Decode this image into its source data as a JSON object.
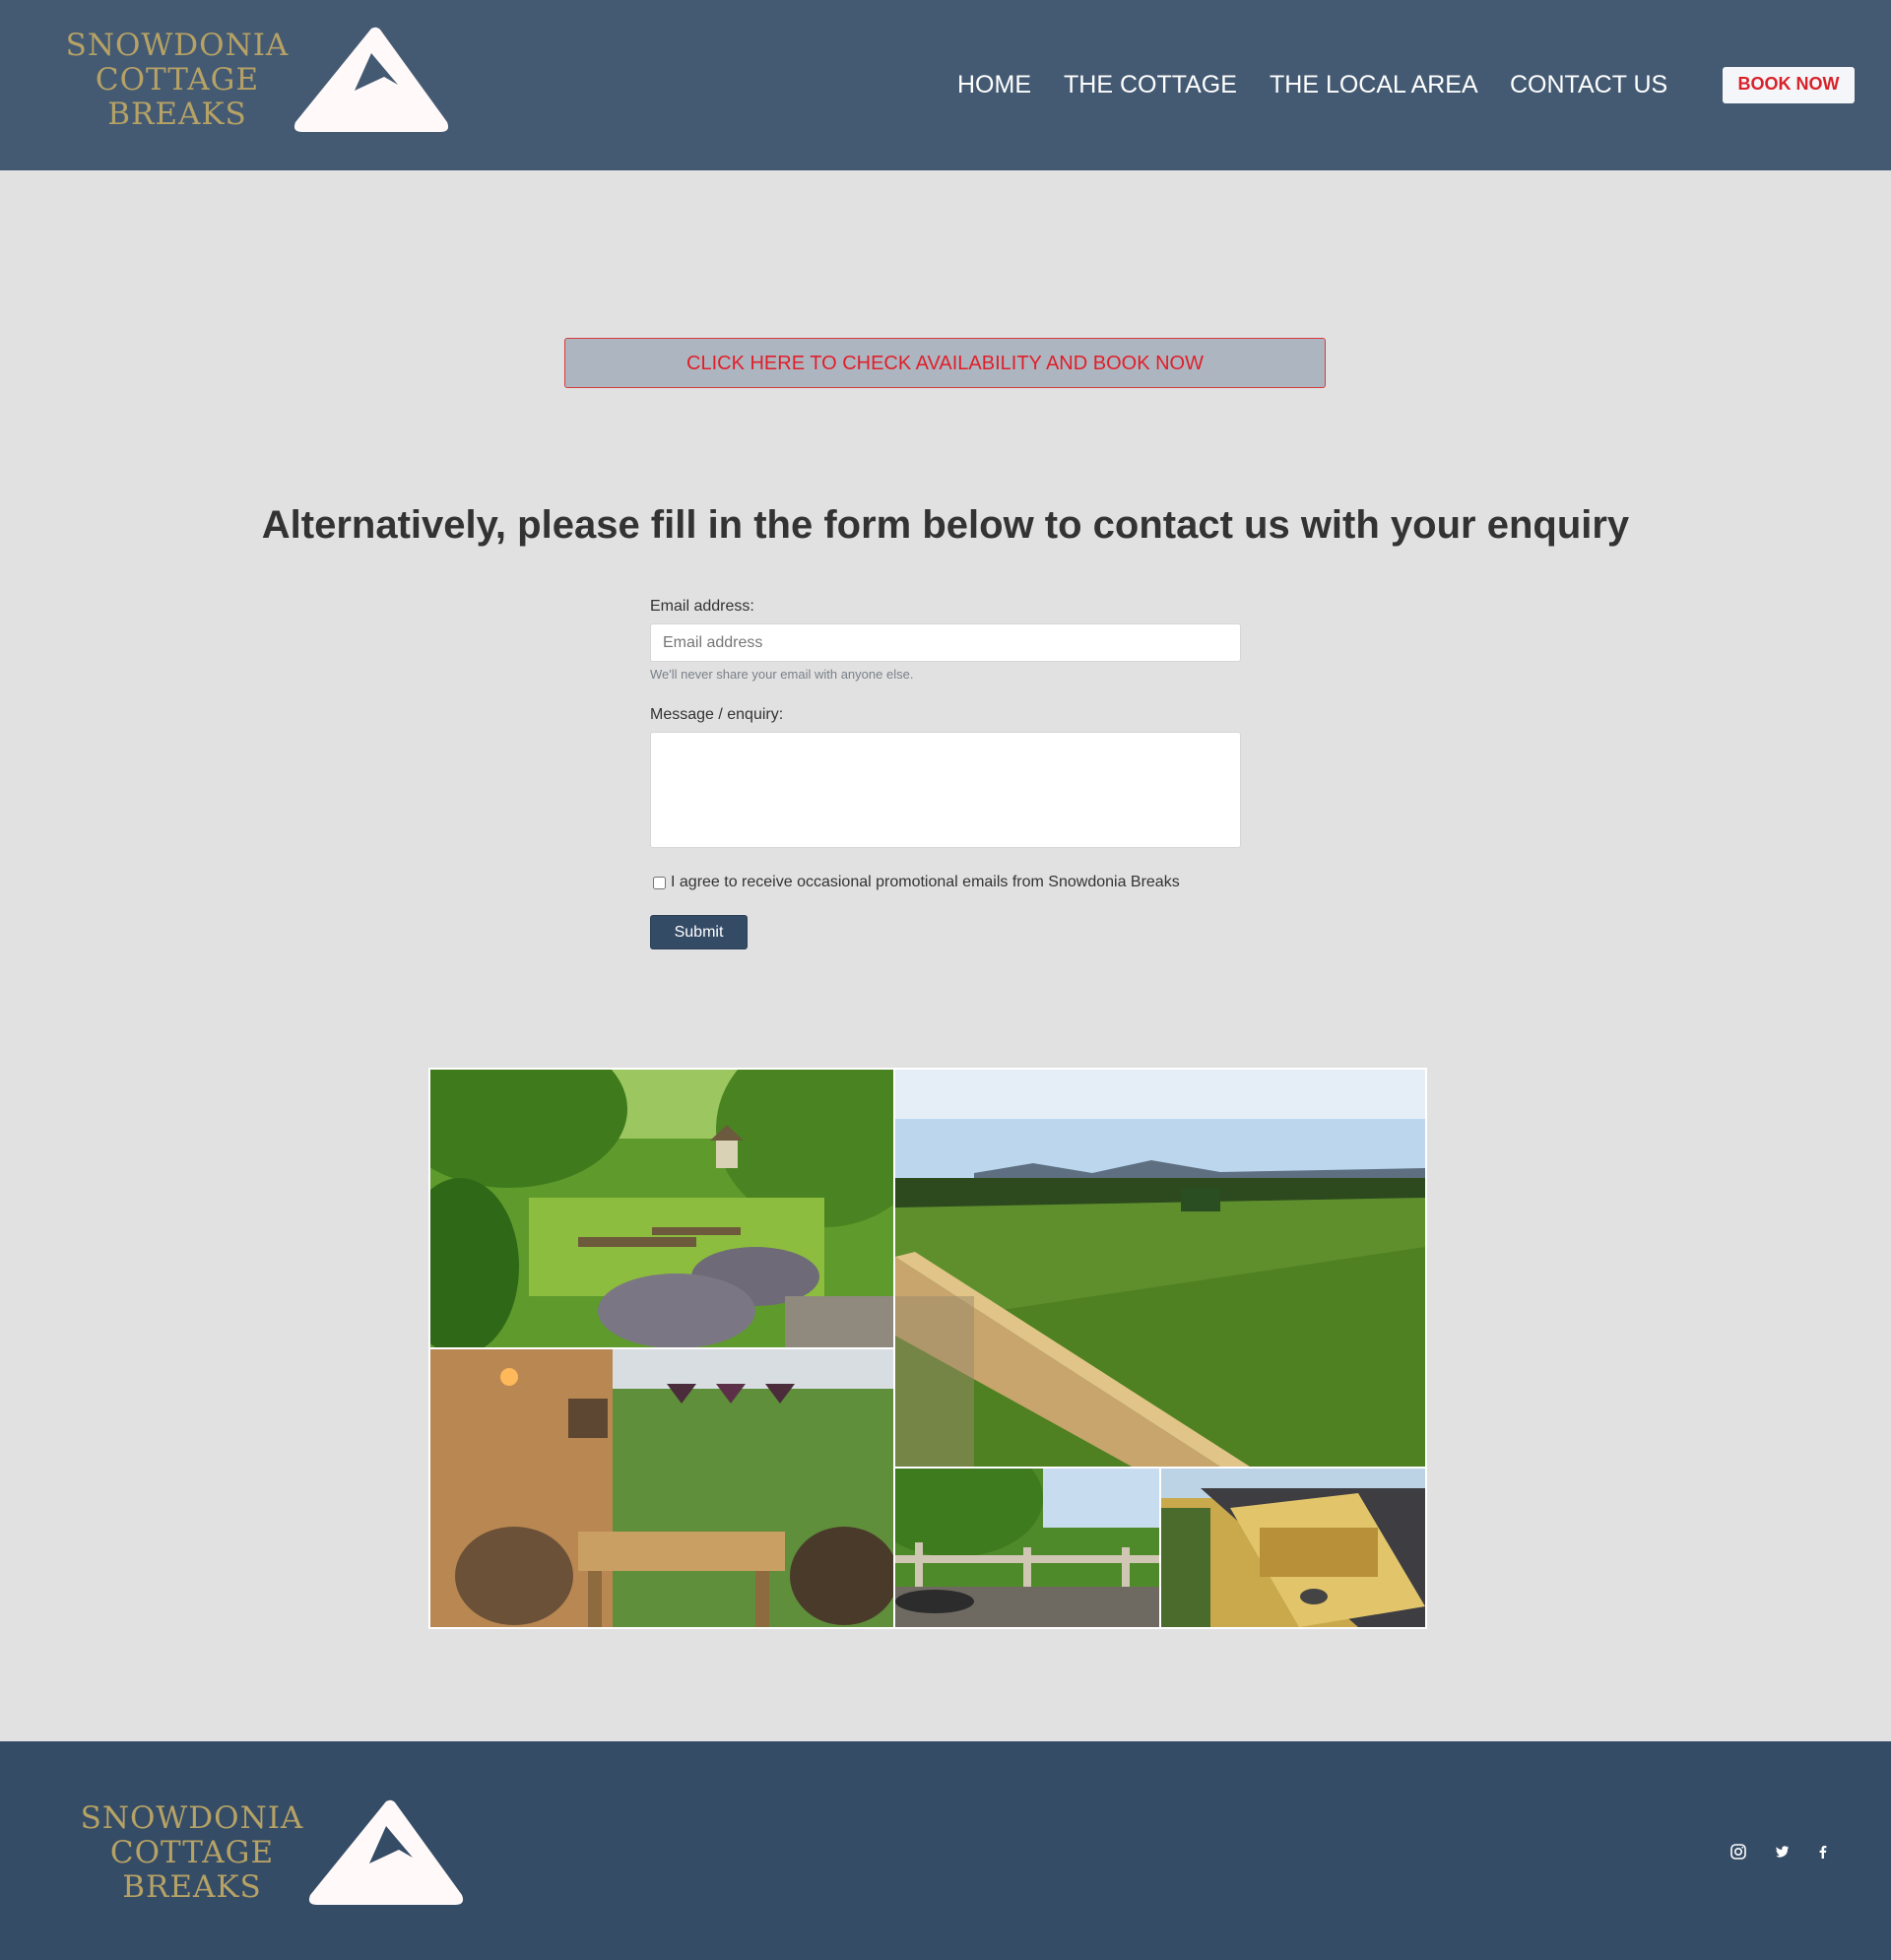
{
  "brand": {
    "name_lines": [
      "SNOWDONIA",
      "COTTAGE",
      "BREAKS"
    ],
    "logo_color": "#b6a265"
  },
  "nav": {
    "items": [
      {
        "label": "HOME"
      },
      {
        "label": "THE COTTAGE"
      },
      {
        "label": "THE LOCAL AREA"
      },
      {
        "label": "CONTACT US"
      }
    ],
    "book_now": "BOOK NOW"
  },
  "availability": {
    "label": "CLICK HERE TO CHECK AVAILABILITY AND BOOK NOW"
  },
  "contact": {
    "heading": "Alternatively, please fill in the form below to contact us with your enquiry",
    "email_label": "Email address:",
    "email_value": "",
    "email_placeholder": "Email address",
    "email_help": "We'll never share your email with anyone else.",
    "message_label": "Message / enquiry:",
    "message_value": "",
    "consent_label": "I agree to receive occasional promotional emails from Snowdonia Breaks",
    "consent_checked": false,
    "submit_label": "Submit"
  },
  "gallery": {
    "photos": [
      "garden-photo",
      "field-photo",
      "veranda-photo",
      "deck-view-photo",
      "hot-tub-deck-photo"
    ]
  },
  "footer": {
    "brand_lines": [
      "SNOWDONIA",
      "COTTAGE",
      "BREAKS"
    ],
    "social": [
      "instagram-icon",
      "twitter-icon",
      "facebook-icon"
    ]
  },
  "colors": {
    "header_bg": "#445a73",
    "footer_bg": "#354c66",
    "page_bg": "#e1e1e1",
    "accent_red": "#d8222a",
    "submit_bg": "#344b66"
  }
}
